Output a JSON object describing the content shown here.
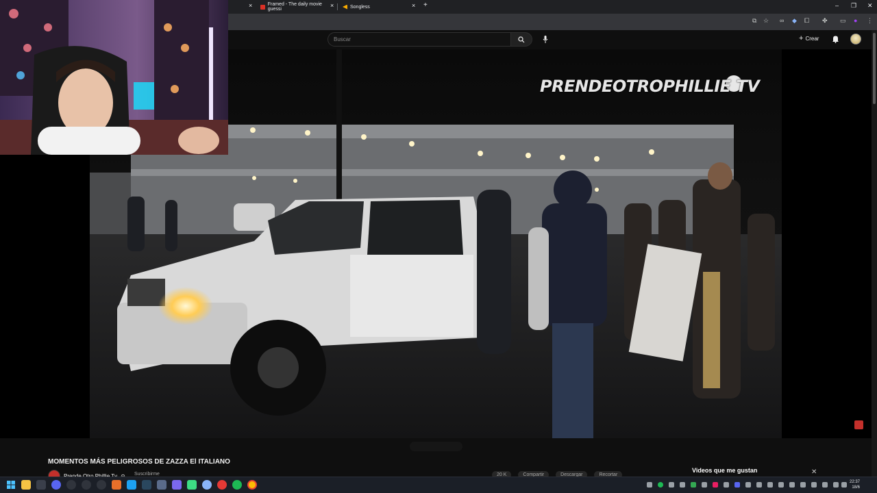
{
  "browser": {
    "tabs": [
      {
        "label": "Framed - The daily movie guessi",
        "favicon_color": "#d93025"
      },
      {
        "label": "Songless",
        "favicon_color": "#f9ab00"
      }
    ],
    "new_tab": "+",
    "window_controls": {
      "minimize": "–",
      "restore": "❐",
      "close": "✕"
    }
  },
  "youtube": {
    "search_placeholder": "Buscar",
    "create_label": "Crear",
    "accent": "#c4302b"
  },
  "video": {
    "watermark": "PRENDEOTROPHILLIE TV",
    "title": "MOMENTOS MÁS PELIGROSOS DE ZAZZA El ITALIANO",
    "channel": "Prende Otro Phillie Tv",
    "verified": "⊙",
    "subscribe": "Suscribirme",
    "actions": [
      "20 K",
      "Compartir",
      "Descargar",
      "Recortar"
    ]
  },
  "playlist": {
    "title": "Videos que me gustan",
    "close": "✕"
  },
  "taskbar": {
    "time": "22:37",
    "date": "18/6"
  }
}
